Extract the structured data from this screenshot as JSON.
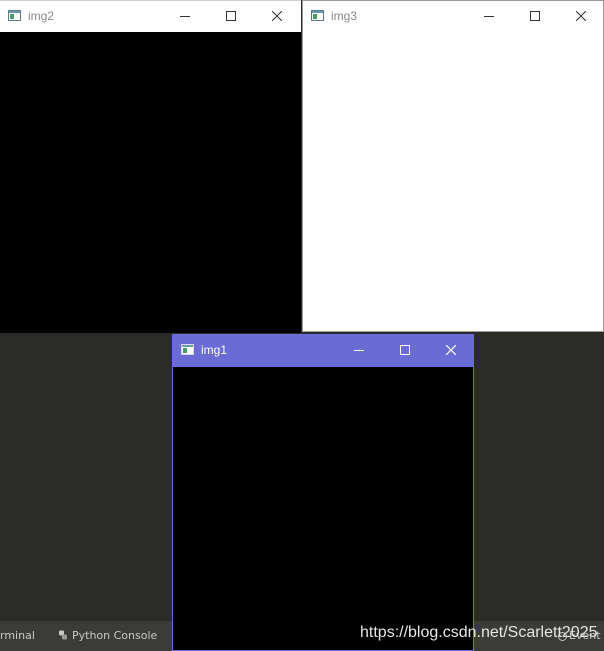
{
  "windows": {
    "img2": {
      "title": "img2",
      "state": "inactive",
      "image_fill": "#000000"
    },
    "img3": {
      "title": "img3",
      "state": "inactive",
      "image_fill": "#ffffff"
    },
    "img1": {
      "title": "img1",
      "state": "active",
      "image_fill": "#000000"
    }
  },
  "ide": {
    "tabs": {
      "terminal": "rminal",
      "python_console": "Python Console",
      "event": "Event"
    }
  },
  "watermark": "https://blog.csdn.net/Scarlett2025",
  "colors": {
    "active_titlebar": "#6b6bd6",
    "inactive_titlebar": "#ffffff",
    "ide_background": "#2b2b27"
  },
  "icons": [
    "app-window-icon",
    "minimize-icon",
    "maximize-icon",
    "close-icon",
    "python-icon",
    "event-icon"
  ]
}
